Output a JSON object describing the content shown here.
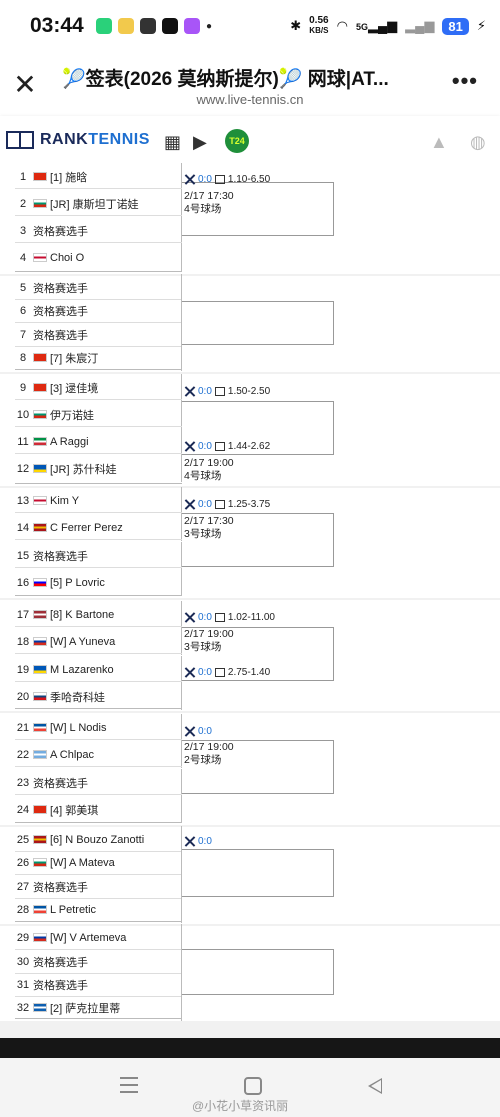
{
  "status_bar": {
    "time": "03:44",
    "net_speed": "0.56",
    "net_unit": "KB/S",
    "signal": "5G",
    "battery": "81"
  },
  "title_bar": {
    "title": "🎾签表(2026 莫纳斯提尔)🎾 网球|AT...",
    "url": "www.live-tennis.cn"
  },
  "header": {
    "logo_prefix": "RANK",
    "logo_suffix": "TENNIS",
    "t24": "T24"
  },
  "players": [
    {
      "no": "1",
      "flag": [
        "#de2910",
        "#de2910",
        "#de2910"
      ],
      "name": "[1] 施晗"
    },
    {
      "no": "2",
      "flag": [
        "#ffffff",
        "#00966e",
        "#d62612"
      ],
      "name": "[JR] 康斯坦丁诺娃"
    },
    {
      "no": "3",
      "flag": null,
      "name": "资格赛选手"
    },
    {
      "no": "4",
      "flag": [
        "#ffffff",
        "#c60c30",
        "#ffffff"
      ],
      "name": "Choi O"
    },
    {
      "no": "5",
      "flag": null,
      "name": "资格赛选手"
    },
    {
      "no": "6",
      "flag": null,
      "name": "资格赛选手"
    },
    {
      "no": "7",
      "flag": null,
      "name": "资格赛选手"
    },
    {
      "no": "8",
      "flag": [
        "#de2910",
        "#de2910",
        "#de2910"
      ],
      "name": "[7] 朱宸汀"
    },
    {
      "no": "9",
      "flag": [
        "#de2910",
        "#de2910",
        "#de2910"
      ],
      "name": "[3] 逯佳境"
    },
    {
      "no": "10",
      "flag": [
        "#ffffff",
        "#00966e",
        "#d62612"
      ],
      "name": "伊万诺娃"
    },
    {
      "no": "11",
      "flag": [
        "#009246",
        "#ffffff",
        "#ce2b37"
      ],
      "name": "A Raggi"
    },
    {
      "no": "12",
      "flag": [
        "#0057b7",
        "#0057b7",
        "#ffd700"
      ],
      "name": "[JR] 苏什科娃"
    },
    {
      "no": "13",
      "flag": [
        "#ffffff",
        "#c60c30",
        "#ffffff"
      ],
      "name": "Kim Y"
    },
    {
      "no": "14",
      "flag": [
        "#aa151b",
        "#f1bf00",
        "#aa151b"
      ],
      "name": "C Ferrer Perez"
    },
    {
      "no": "15",
      "flag": null,
      "name": "资格赛选手"
    },
    {
      "no": "16",
      "flag": [
        "#ffffff",
        "#0000ff",
        "#ff0000"
      ],
      "name": "[5] P Lovric"
    },
    {
      "no": "17",
      "flag": [
        "#9e3039",
        "#ffffff",
        "#9e3039"
      ],
      "name": "[8] K Bartone"
    },
    {
      "no": "18",
      "flag": [
        "#ffffff",
        "#0039a6",
        "#d52b1e"
      ],
      "name": "[W] A Yuneva"
    },
    {
      "no": "19",
      "flag": [
        "#0057b7",
        "#0057b7",
        "#ffd700"
      ],
      "name": "M Lazarenko"
    },
    {
      "no": "20",
      "flag": [
        "#ffffff",
        "#11457e",
        "#d7141a"
      ],
      "name": "季哈奇科娃"
    },
    {
      "no": "21",
      "flag": [
        "#0055a4",
        "#ffffff",
        "#ef4135"
      ],
      "name": "[W] L Nodis"
    },
    {
      "no": "22",
      "flag": [
        "#74acdf",
        "#ffffff",
        "#74acdf"
      ],
      "name": "A Chlpac"
    },
    {
      "no": "23",
      "flag": null,
      "name": "资格赛选手"
    },
    {
      "no": "24",
      "flag": [
        "#de2910",
        "#de2910",
        "#de2910"
      ],
      "name": "[4] 郭美琪"
    },
    {
      "no": "25",
      "flag": [
        "#aa151b",
        "#f1bf00",
        "#aa151b"
      ],
      "name": "[6] N Bouzo Zanotti"
    },
    {
      "no": "26",
      "flag": [
        "#ffffff",
        "#00966e",
        "#d62612"
      ],
      "name": "[W] A Mateva"
    },
    {
      "no": "27",
      "flag": null,
      "name": "资格赛选手"
    },
    {
      "no": "28",
      "flag": [
        "#0055a4",
        "#ffffff",
        "#ef4135"
      ],
      "name": "L Petretic"
    },
    {
      "no": "29",
      "flag": [
        "#ffffff",
        "#0039a6",
        "#d52b1e"
      ],
      "name": "[W] V Artemeva"
    },
    {
      "no": "30",
      "flag": null,
      "name": "资格赛选手"
    },
    {
      "no": "31",
      "flag": null,
      "name": "资格赛选手"
    },
    {
      "no": "32",
      "flag": [
        "#0d5eaf",
        "#ffffff",
        "#0d5eaf"
      ],
      "name": "[2] 萨克拉里蒂"
    }
  ],
  "odds": [
    {
      "zero": "0:0",
      "value": "1.10-6.50"
    },
    {
      "zero": "0:0",
      "value": "1.50-2.50"
    },
    {
      "zero": "0:0",
      "value": "1.44-2.62"
    },
    {
      "zero": "0:0",
      "value": "1.25-3.75"
    },
    {
      "zero": "0:0",
      "value": "1.02-11.00"
    },
    {
      "zero": "0:0",
      "value": "2.75-1.40"
    },
    {
      "zero": "0:0",
      "value": ""
    },
    {
      "zero": "0:0",
      "value": ""
    }
  ],
  "schedules": [
    {
      "time": "2/17 17:30",
      "court": "4号球场"
    },
    {
      "time": "2/17 19:00",
      "court": "4号球场"
    },
    {
      "time": "2/17 17:30",
      "court": "3号球场"
    },
    {
      "time": "2/17 19:00",
      "court": "3号球场"
    },
    {
      "time": "2/17 19:00",
      "court": "2号球场"
    }
  ],
  "watermark": "@小花小草资讯丽"
}
